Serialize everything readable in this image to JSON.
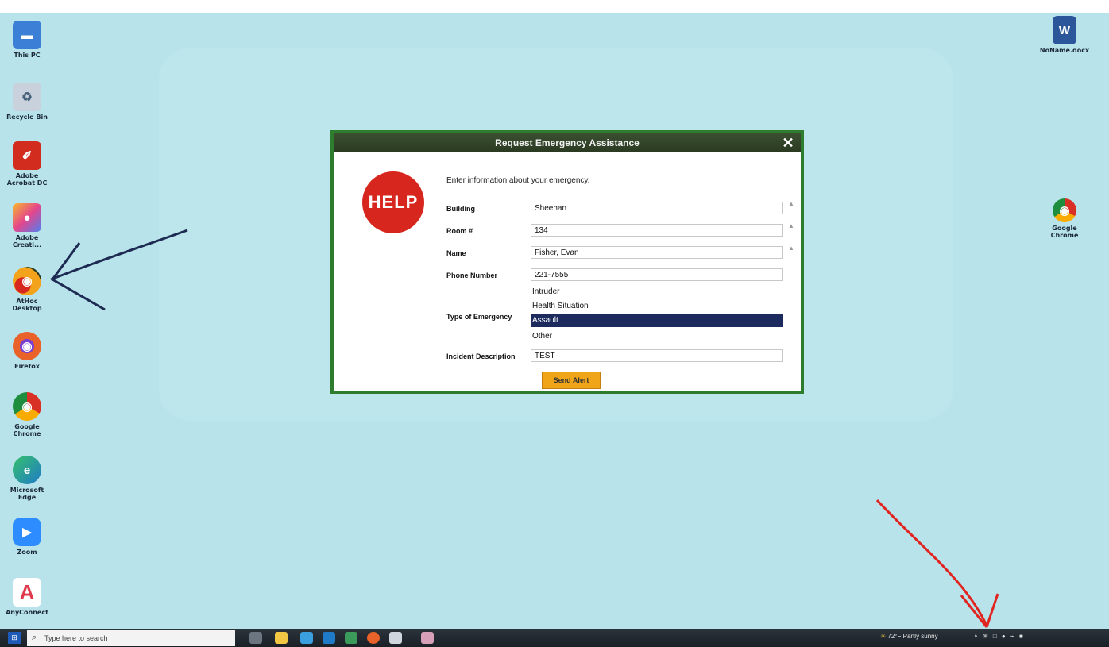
{
  "desktop": {
    "left_icons": [
      {
        "name": "this-pc-icon",
        "label": "This PC",
        "color": "#3b7fd6",
        "glyph": "▬"
      },
      {
        "name": "recycle-bin-icon",
        "label": "Recycle Bin",
        "color": "#c9d2dc",
        "glyph": "♻"
      },
      {
        "name": "acrobat-reader-icon",
        "label": "Adobe Acrobat DC",
        "color": "#d22c1f",
        "glyph": "✐"
      },
      {
        "name": "creative-cloud-icon",
        "label": "Adobe Creati...",
        "color": "#e4468c",
        "glyph": "●"
      },
      {
        "name": "alert-app-icon",
        "label": "AtHoc Desktop",
        "color": "#f2a31b",
        "glyph": "◉"
      },
      {
        "name": "firefox-icon",
        "label": "Firefox",
        "color": "#e8622a",
        "glyph": "◉"
      },
      {
        "name": "chrome-icon",
        "label": "Google Chrome",
        "color": "#2f9a4a",
        "glyph": "◉"
      },
      {
        "name": "edge-icon",
        "label": "Microsoft Edge",
        "color": "#1f7ac8",
        "glyph": "e"
      },
      {
        "name": "zoom-icon",
        "label": "Zoom",
        "color": "#2d8cff",
        "glyph": "▶"
      },
      {
        "name": "anyconnect-icon",
        "label": "AnyConnect",
        "color": "#e03a4e",
        "glyph": "A"
      }
    ],
    "right_icons": [
      {
        "name": "word-doc-icon",
        "label": "NoName.docx",
        "color": "#2b579a",
        "glyph": "W"
      },
      {
        "name": "chrome-shortcut-icon",
        "label": "Google Chrome",
        "color": "#2f9a4a",
        "glyph": "◉"
      }
    ]
  },
  "dialog": {
    "title": "Request Emergency Assistance",
    "close": "✕",
    "help_badge": "HELP",
    "intro": "Enter information about your emergency.",
    "fields": {
      "building": {
        "label": "Building",
        "value": "Sheehan"
      },
      "room": {
        "label": "Room #",
        "value": "134"
      },
      "name": {
        "label": "Name",
        "value": "Fisher, Evan"
      },
      "phone": {
        "label": "Phone Number",
        "value": "221-7555"
      },
      "emergency": {
        "label": "Type of Emergency",
        "options": [
          "Intruder",
          "Health Situation",
          "Assault",
          "Other"
        ],
        "selected": "Assault"
      },
      "description": {
        "label": "Incident Description",
        "value": "TEST"
      }
    },
    "send_button": "Send Alert"
  },
  "taskbar": {
    "start": "⊞",
    "search_placeholder": "Type here to search",
    "weather": "72°F  Partly sunny",
    "tray": "˄  ✉  □  ●  ⌁  ■"
  }
}
